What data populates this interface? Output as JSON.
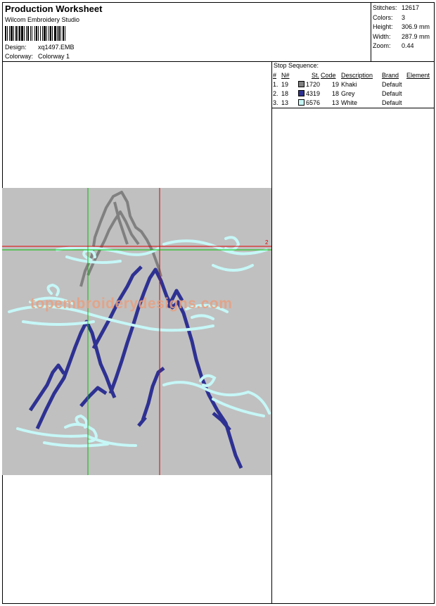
{
  "header": {
    "title": "Production Worksheet",
    "software": "Wilcom  Embroidery Studio",
    "design_label": "Design:",
    "design_value": "xq1497.EMB",
    "colorway_label": "Colorway:",
    "colorway_value": "Colorway 1"
  },
  "stats": [
    {
      "label": "Stitches:",
      "value": "12617"
    },
    {
      "label": "Colors:",
      "value": "3"
    },
    {
      "label": "Height:",
      "value": "306.9 mm"
    },
    {
      "label": "Width:",
      "value": "287.9 mm"
    },
    {
      "label": "Zoom:",
      "value": "0.44"
    }
  ],
  "stop_sequence": {
    "title": "Stop Sequence:",
    "headers": [
      "#",
      "N#",
      "St.",
      "Code",
      "Description",
      "Brand",
      "Element"
    ],
    "rows": [
      {
        "num": "1.",
        "n": "19",
        "color": "#808080",
        "st": "1720",
        "code": "19",
        "desc": "Khaki",
        "brand": "Default",
        "element": ""
      },
      {
        "num": "2.",
        "n": "18",
        "color": "#2e3192",
        "st": "4319",
        "code": "18",
        "desc": "Grey",
        "brand": "Default",
        "element": ""
      },
      {
        "num": "3.",
        "n": "13",
        "color": "#c6f7f7",
        "st": "6576",
        "code": "13",
        "desc": "White",
        "brand": "Default",
        "element": ""
      }
    ]
  },
  "preview": {
    "watermark": "topembroiderydesigns.com",
    "marker_label": "2",
    "colors": {
      "background": "#c0c0c0",
      "guide_green": "#00c000",
      "guide_red": "#e00000"
    }
  }
}
